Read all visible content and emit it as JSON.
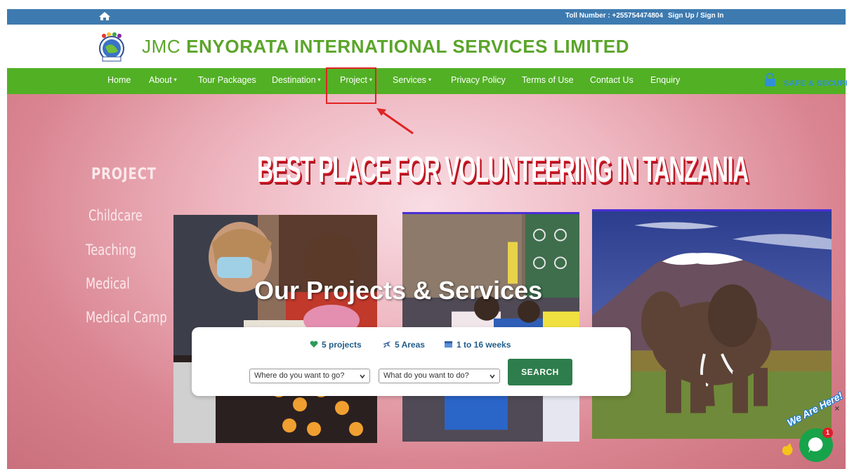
{
  "topbar": {
    "toll": "Toll Number : +255754474804",
    "signup": "Sign Up / Sign In"
  },
  "header": {
    "brand_prefix": "JMC",
    "brand_name": "ENYORATA INTERNATIONAL SERVICES LIMITED"
  },
  "nav": {
    "items": [
      {
        "label": "Home"
      },
      {
        "label": "About"
      },
      {
        "label": "Tour Packages"
      },
      {
        "label": "Destination"
      },
      {
        "label": "Project"
      },
      {
        "label": "Services"
      },
      {
        "label": "Privacy Policy"
      },
      {
        "label": "Terms of Use"
      },
      {
        "label": "Contact Us"
      },
      {
        "label": "Enquiry"
      }
    ],
    "caret": "▾",
    "safe_label": "SAFE & SECURE"
  },
  "hero": {
    "title": "BEST PLACE FOR VOLUNTEERING IN TANZANIA",
    "side_heading": "PROJECT",
    "side_items": [
      "Childcare",
      "Teaching",
      "Medical",
      "Medical Camp"
    ],
    "overlay_title": "Our Projects & Services"
  },
  "search": {
    "stats": [
      "5 projects",
      "5 Areas",
      "1 to 16 weeks"
    ],
    "where_placeholder": "Where do you want to go?",
    "what_placeholder": "What do you want to do?",
    "button": "SEARCH"
  },
  "chat": {
    "label": "We Are Here!",
    "notification_count": "1",
    "close": "×"
  },
  "colors": {
    "topbar": "#3d7ab0",
    "nav": "#52b025",
    "brand": "#5ba52a",
    "search_button": "#2e7d4c",
    "highlight": "#e02424"
  }
}
